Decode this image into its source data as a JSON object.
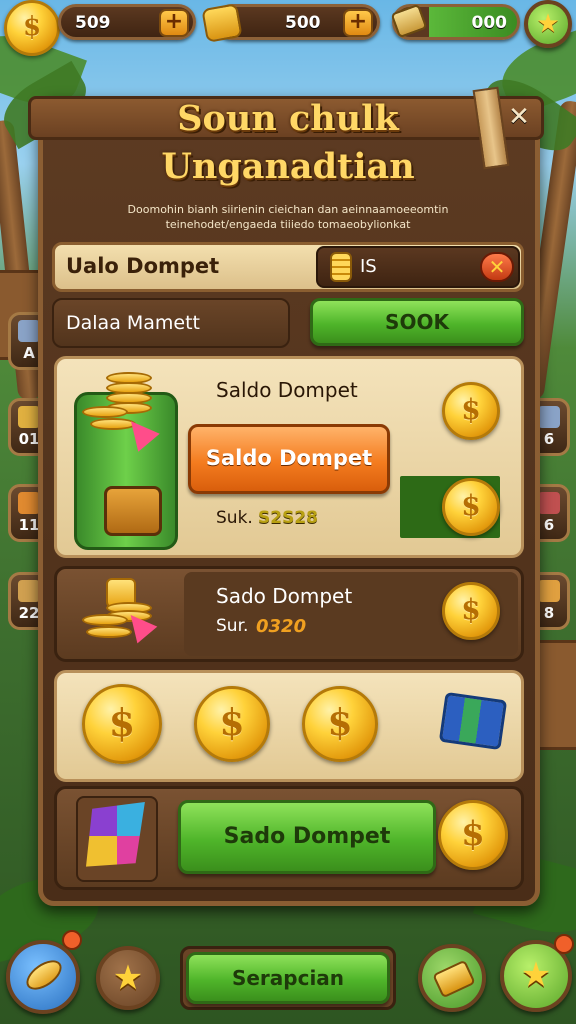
{
  "top_bar": {
    "coins_value": "509",
    "gems_value": "500",
    "cash_value": "000",
    "plus_symbol": "+"
  },
  "dialog": {
    "title_line1": "Soun chulk",
    "title_line2": "Unganadtian",
    "description": "Doomohin bianh siirienin cieichan dan aeinnaamoeeomtin teinehodet/engaeda tiiiedo tomaeobylionkat",
    "close_symbol": "✕"
  },
  "wallet_row": {
    "label": "Ualo Dompet",
    "amount": "IS",
    "clear_symbol": "✕"
  },
  "balance_row": {
    "label": "Dalaa Mamett",
    "button_label": "SOOK"
  },
  "offer1": {
    "title": "Saldo Dompet",
    "button_label": "Saldo Dompet",
    "sub_prefix": "Suk.",
    "sub_value": "S2S28"
  },
  "offer2": {
    "title": "Sado Dompet",
    "sub_prefix": "Sur.",
    "sub_value": "0320"
  },
  "coin_symbol": "$",
  "offer4": {
    "button_label": "Sado Dompet"
  },
  "side_left": [
    "A",
    "01",
    "11",
    "22"
  ],
  "side_right": [
    "6",
    "6",
    "8",
    "6"
  ],
  "bottom_bar": {
    "center_button_label": "Serapcian"
  },
  "colors": {
    "accent_green": "#4fb52a",
    "accent_orange": "#f47c1f",
    "wood_brown": "#5d3b22",
    "gold": "#ffd23a"
  }
}
